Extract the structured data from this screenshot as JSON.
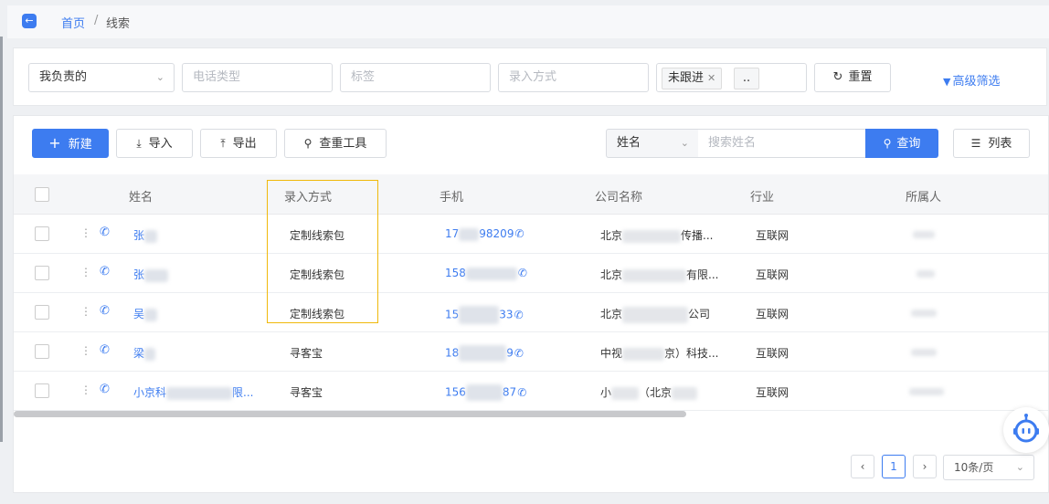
{
  "breadcrumb": {
    "home": "首页",
    "separator": "/",
    "current": "线索"
  },
  "filters": {
    "owner": "我负责的",
    "phone_type_placeholder": "电话类型",
    "tag_placeholder": "标签",
    "entry_placeholder": "录入方式",
    "status_tag": "未跟进",
    "status_more": "..",
    "reset_label": "重置",
    "advanced_label": "高级筛选"
  },
  "toolbar": {
    "new_label": "新建",
    "import_label": "导入",
    "export_label": "导出",
    "dedupe_label": "查重工具",
    "search_type": "姓名",
    "search_placeholder": "搜索姓名",
    "search_label": "查询",
    "list_label": "列表"
  },
  "table": {
    "columns": [
      "姓名",
      "录入方式",
      "手机",
      "公司名称",
      "行业",
      "所属人"
    ],
    "rows": [
      {
        "name": "张",
        "entry": "定制线索包",
        "phone_pre": "17",
        "phone_post": "98209",
        "company_pre": "北京",
        "company_post": "传播...",
        "industry": "互联网"
      },
      {
        "name": "张",
        "entry": "定制线索包",
        "phone_pre": "158",
        "phone_post": "",
        "company_pre": "北京",
        "company_post": "有限...",
        "industry": "互联网"
      },
      {
        "name": "吴",
        "entry": "定制线索包",
        "phone_pre": "15",
        "phone_post": "33",
        "company_pre": "北京",
        "company_post": "公司",
        "industry": "互联网"
      },
      {
        "name": "梁",
        "entry": "寻客宝",
        "phone_pre": "18",
        "phone_post": "9",
        "company_pre": "中视",
        "company_post": "京）科技...",
        "industry": "互联网"
      },
      {
        "name": "小京科",
        "name_post": "限...",
        "entry": "寻客宝",
        "phone_pre": "156",
        "phone_post": "87",
        "company_pre": "小",
        "company_post": "（北京",
        "industry": "互联网"
      }
    ]
  },
  "pagination": {
    "current": "1",
    "page_size": "10条/页"
  },
  "colors": {
    "primary": "#3d7cf0",
    "highlight": "#f0b90b"
  }
}
